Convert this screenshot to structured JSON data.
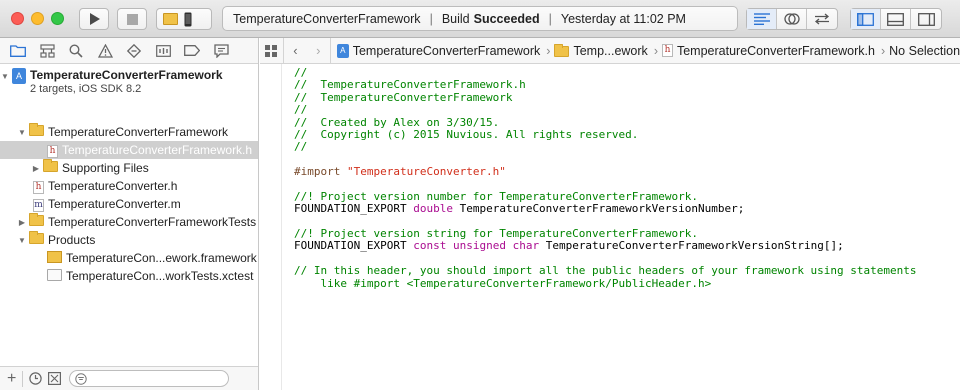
{
  "toolbar": {
    "activity_file": "TemperatureConverterFramework",
    "activity_status_label": "Build",
    "activity_status_value": "Succeeded",
    "activity_time": "Yesterday at 11:02 PM"
  },
  "navigator": {
    "project": {
      "name": "TemperatureConverterFramework",
      "subtitle": "2 targets, iOS SDK 8.2"
    },
    "items": [
      {
        "label": "TemperatureConverterFramework"
      },
      {
        "label": "TemperatureConverterFramework.h"
      },
      {
        "label": "Supporting Files"
      },
      {
        "label": "TemperatureConverter.h"
      },
      {
        "label": "TemperatureConverter.m"
      },
      {
        "label": "TemperatureConverterFrameworkTests"
      },
      {
        "label": "Products"
      },
      {
        "label": "TemperatureCon...ework.framework"
      },
      {
        "label": "TemperatureCon...workTests.xctest"
      }
    ]
  },
  "jumpbar": {
    "crumbs": [
      "TemperatureConverterFramework",
      "Temp...ework",
      "TemperatureConverterFramework.h",
      "No Selection"
    ]
  },
  "code": {
    "lines": [
      {
        "t": "//",
        "k": "comment"
      },
      {
        "t": "//  TemperatureConverterFramework.h",
        "k": "comment"
      },
      {
        "t": "//  TemperatureConverterFramework",
        "k": "comment"
      },
      {
        "t": "//",
        "k": "comment"
      },
      {
        "t": "//  Created by Alex on 3/30/15.",
        "k": "comment"
      },
      {
        "t": "//  Copyright (c) 2015 Nuvious. All rights reserved.",
        "k": "comment"
      },
      {
        "t": "//",
        "k": "comment"
      },
      {
        "t": "",
        "k": "plain"
      },
      {
        "parts": [
          {
            "t": "#import ",
            "k": "pre"
          },
          {
            "t": "\"TemperatureConverter.h\"",
            "k": "str"
          }
        ]
      },
      {
        "t": "",
        "k": "plain"
      },
      {
        "t": "//! Project version number for TemperatureConverterFramework.",
        "k": "comment"
      },
      {
        "parts": [
          {
            "t": "FOUNDATION_EXPORT ",
            "k": "plain"
          },
          {
            "t": "double",
            "k": "kw"
          },
          {
            "t": " TemperatureConverterFrameworkVersionNumber;",
            "k": "plain"
          }
        ]
      },
      {
        "t": "",
        "k": "plain"
      },
      {
        "t": "//! Project version string for TemperatureConverterFramework.",
        "k": "comment"
      },
      {
        "parts": [
          {
            "t": "FOUNDATION_EXPORT ",
            "k": "plain"
          },
          {
            "t": "const",
            "k": "kw"
          },
          {
            "t": " ",
            "k": "plain"
          },
          {
            "t": "unsigned",
            "k": "kw"
          },
          {
            "t": " ",
            "k": "plain"
          },
          {
            "t": "char",
            "k": "kw"
          },
          {
            "t": " TemperatureConverterFrameworkVersionString[];",
            "k": "plain"
          }
        ]
      },
      {
        "t": "",
        "k": "plain"
      },
      {
        "t": "// In this header, you should import all the public headers of your framework using statements",
        "k": "comment"
      },
      {
        "t": "    like #import <TemperatureConverterFramework/PublicHeader.h>",
        "k": "comment"
      }
    ]
  }
}
